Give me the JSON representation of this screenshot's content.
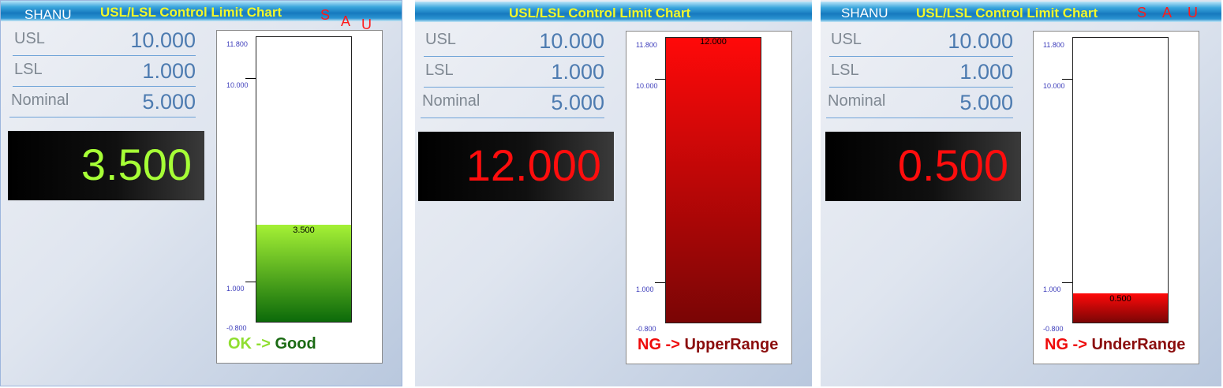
{
  "app": {
    "brand": "SHANU",
    "title": "USL/LSL Control Limit Chart",
    "sau": [
      "S",
      "A",
      "U"
    ]
  },
  "labels": {
    "usl": "USL",
    "lsl": "LSL",
    "nominal": "Nominal"
  },
  "ticks": [
    "11.800",
    "10.000",
    "1.000",
    "-0.800"
  ],
  "panels": [
    {
      "usl": "10.000",
      "lsl": "1.000",
      "nominal": "5.000",
      "value": "3.500",
      "value_color": "#a6ff36",
      "bar_label": "3.500",
      "bar_value": 3.5,
      "bar_top_color": "#a5f135",
      "bar_bottom_color": "#0c6a0a",
      "status_prefix": "OK -> ",
      "status_word": "Good",
      "prefix_color": "#8fde2f",
      "word_color": "#1b6b14"
    },
    {
      "usl": "10.000",
      "lsl": "1.000",
      "nominal": "5.000",
      "value": "12.000",
      "value_color": "#ff0d0d",
      "bar_label": "12.000",
      "bar_value": 12.0,
      "bar_top_color": "#ff0909",
      "bar_bottom_color": "#7a0505",
      "status_prefix": "NG -> ",
      "status_word": "UpperRange",
      "prefix_color": "#ee0a0a",
      "word_color": "#8b0d0d"
    },
    {
      "usl": "10.000",
      "lsl": "1.000",
      "nominal": "5.000",
      "value": "0.500",
      "value_color": "#ff0d0d",
      "bar_label": "0.500",
      "bar_value": 0.5,
      "bar_top_color": "#ff0909",
      "bar_bottom_color": "#7a0505",
      "status_prefix": "NG -> ",
      "status_word": "UnderRange",
      "prefix_color": "#ee0a0a",
      "word_color": "#8b0d0d"
    }
  ],
  "chart_data": [
    {
      "type": "bar",
      "categories": [
        ""
      ],
      "values": [
        3.5
      ],
      "data_labels": [
        "3.500"
      ],
      "ylim": [
        -0.8,
        11.8
      ],
      "ytick_labels": [
        "11.800",
        "10.000",
        "1.000",
        "-0.800"
      ]
    },
    {
      "type": "bar",
      "categories": [
        ""
      ],
      "values": [
        12.0
      ],
      "data_labels": [
        "12.000"
      ],
      "ylim": [
        -0.8,
        11.8
      ],
      "ytick_labels": [
        "11.800",
        "10.000",
        "1.000",
        "-0.800"
      ]
    },
    {
      "type": "bar",
      "categories": [
        ""
      ],
      "values": [
        0.5
      ],
      "data_labels": [
        "0.500"
      ],
      "ylim": [
        -0.8,
        11.8
      ],
      "ytick_labels": [
        "11.800",
        "10.000",
        "1.000",
        "-0.800"
      ]
    }
  ]
}
